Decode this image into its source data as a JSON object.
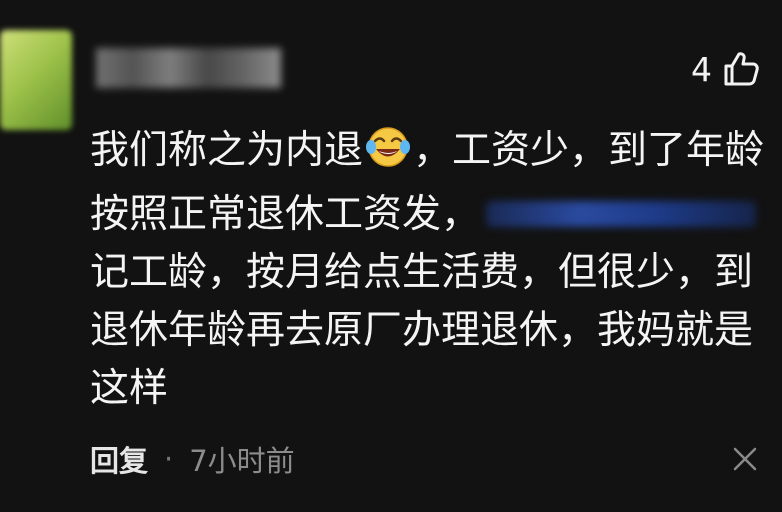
{
  "comment": {
    "username": "",
    "like_count": "4",
    "lines": [
      "我们称之为内退",
      "，工资少，到了年龄",
      "按照正常退休工资发，",
      "记工龄，按月给点生活费，但很少，到",
      "退休年龄再去原厂办理退休，我妈就是",
      "这样"
    ],
    "reply_label": "回复",
    "separator": "·",
    "time": "7小时前"
  },
  "icons": {
    "like": "thumbs-up-icon",
    "emoji": "laughing-tears-emoji",
    "close": "close-icon"
  },
  "colors": {
    "background": "#121212",
    "text": "#f4f4f4",
    "muted": "#8c8c8c"
  }
}
